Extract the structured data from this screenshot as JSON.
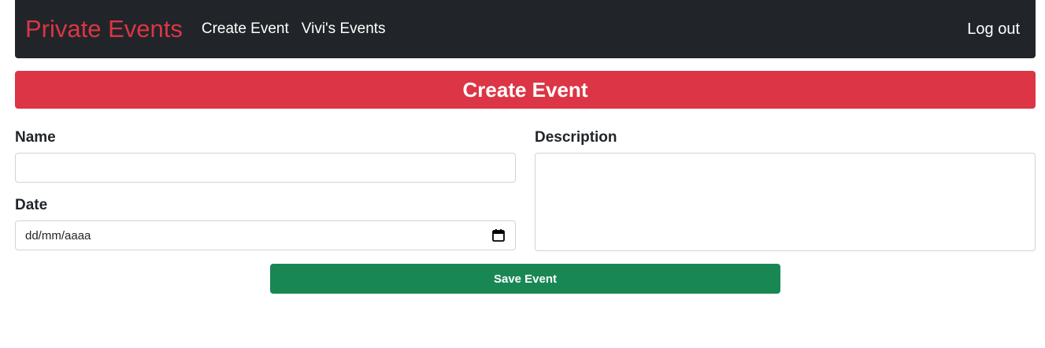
{
  "colors": {
    "navbar_bg": "#212529",
    "brand": "#dc3545",
    "banner_bg": "#dc3545",
    "save_button_bg": "#198754"
  },
  "navbar": {
    "brand": "Private Events",
    "links": [
      {
        "label": "Create Event"
      },
      {
        "label": "Vivi's Events"
      }
    ],
    "logout_label": "Log out"
  },
  "banner": {
    "title": "Create Event"
  },
  "form": {
    "name_label": "Name",
    "name_value": "",
    "date_label": "Date",
    "date_placeholder": "dd/mm/aaaa",
    "date_icon": "calendar-icon",
    "description_label": "Description",
    "description_value": "",
    "save_label": "Save Event"
  }
}
